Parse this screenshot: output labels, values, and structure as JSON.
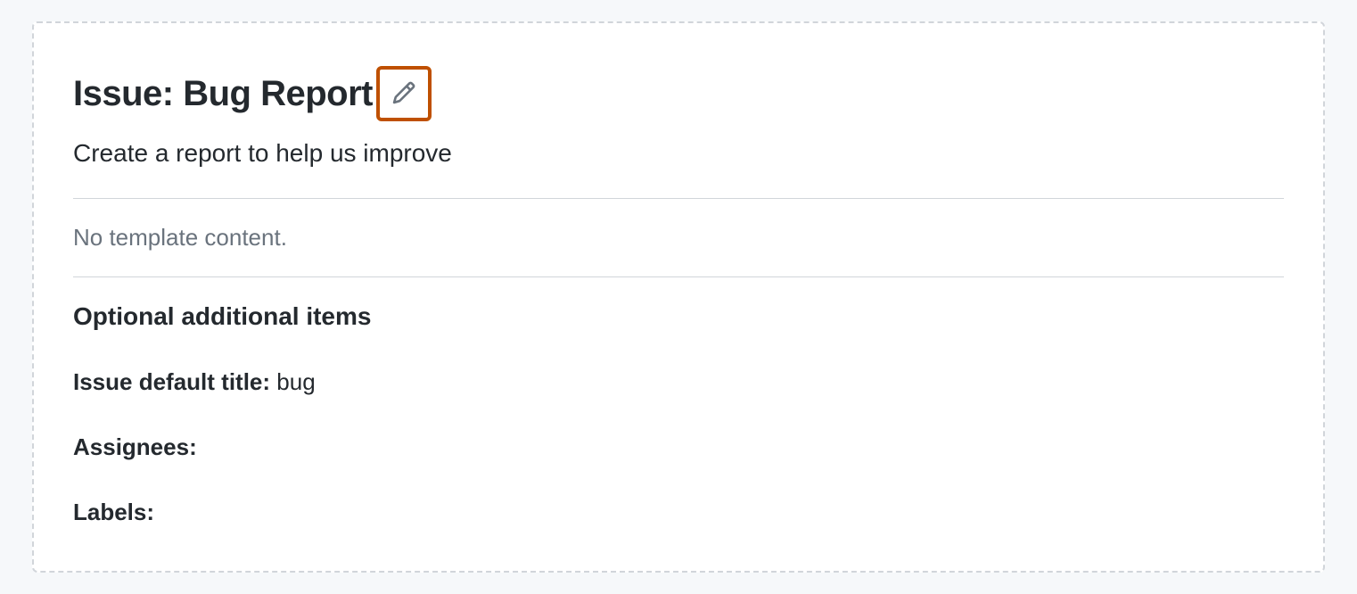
{
  "header": {
    "title": "Issue: Bug Report",
    "description": "Create a report to help us improve"
  },
  "content": {
    "empty_message": "No template content."
  },
  "optional": {
    "heading": "Optional additional items",
    "default_title_label": "Issue default title:",
    "default_title_value": "bug",
    "assignees_label": "Assignees:",
    "assignees_value": "",
    "labels_label": "Labels:",
    "labels_value": ""
  }
}
